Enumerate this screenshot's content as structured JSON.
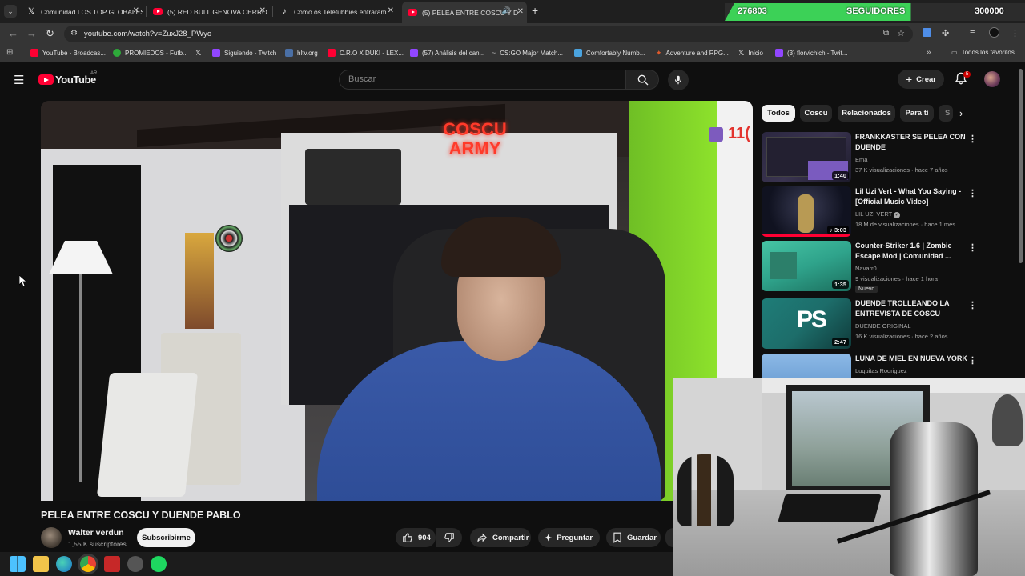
{
  "browser": {
    "tabs": [
      {
        "title": "Comunidad LOS TOP GLOBALES",
        "icon": "x-icon"
      },
      {
        "title": "(5) RED BULL GENOVA CERRO /",
        "icon": "youtube-icon"
      },
      {
        "title": "Como os Teletubbies entraram",
        "icon": "tiktok-icon"
      },
      {
        "title": "(5) PELEA ENTRE COSCU Y D",
        "icon": "youtube-icon",
        "active": true
      }
    ],
    "new_tab": "+",
    "url": "youtube.com/watch?v=ZuxJ28_PWyo",
    "bookmarks": [
      {
        "label": "YouTube - Broadcas...",
        "color": "#ff0033"
      },
      {
        "label": "PROMIEDOS - Futb...",
        "color": "#2eaa3a"
      },
      {
        "label": "",
        "color": "#ffffff"
      },
      {
        "label": "Siguiendo - Twitch",
        "color": "#9146ff"
      },
      {
        "label": "hltv.org",
        "color": "#4a6fa5"
      },
      {
        "label": "C.R.O X DUKI - LEX...",
        "color": "#ff0033"
      },
      {
        "label": "(57) Análisis del can...",
        "color": "#9146ff"
      },
      {
        "label": "CS:GO Major Match...",
        "color": "#bbbbbb"
      },
      {
        "label": "Comfortably Numb...",
        "color": "#4aa3df"
      },
      {
        "label": "Adventure and RPG...",
        "color": "#e05a2b"
      },
      {
        "label": "Inicio",
        "color": "#ffffff"
      },
      {
        "label": "(3) florvichich - Twit...",
        "color": "#9146ff"
      }
    ],
    "all_bookmarks": "Todos los favoritos"
  },
  "followers_overlay": {
    "current": "276803",
    "label": "SEGUIDORES",
    "goal": "300000",
    "progress": 0.62
  },
  "youtube": {
    "logo_text": "YouTube",
    "region": "AR",
    "search_placeholder": "Buscar",
    "create_label": "Crear",
    "notifications": "5",
    "video": {
      "title": "PELEA ENTRE COSCU Y DUENDE PABLO",
      "channel": "Walter verdun",
      "subscribers": "1,55 K suscriptores",
      "subscribe_label": "Subscribirme",
      "likes": "904",
      "share_label": "Compartir",
      "ask_label": "Preguntar",
      "save_label": "Guardar",
      "overlay_sign": "COSCU ARMY",
      "overlay_counter": "11("
    },
    "chips": [
      "Todos",
      "Coscu",
      "Relacionados",
      "Para ti",
      "S"
    ],
    "recommendations": [
      {
        "title": "FRANKKASTER SE PELEA CON DUENDE",
        "channel": "Ema",
        "stats": "37 K visualizaciones · hace 7 años",
        "duration": "1:40",
        "thumb": "#3a3450"
      },
      {
        "title": "Lil Uzi Vert - What You Saying - [Official Music Video]",
        "channel": "LIL UZI VERT",
        "verified": true,
        "stats": "18 M de visualizaciones · hace 1 mes",
        "duration": "3:03",
        "thumb": "#1a1c2c"
      },
      {
        "title": "Counter-Striker 1.6 | Zombie Escape Mod | Comunidad ...",
        "channel": "Navarr0",
        "stats": "9 visualizaciones · hace 1 hora",
        "duration": "1:35",
        "new_tag": "Nuevo",
        "thumb": "#2fa38b"
      },
      {
        "title": "DUENDE TROLLEANDO LA ENTREVISTA DE COSCU",
        "channel": "DUENDE ORIGINAL",
        "stats": "16 K visualizaciones · hace 2 años",
        "duration": "2:47",
        "thumb": "#1d6d6a"
      },
      {
        "title": "LUNA DE MIEL EN NUEVA YORK",
        "channel": "Luquitas Rodriguez",
        "stats": "",
        "duration": "",
        "thumb": "#5a8fc9"
      }
    ]
  }
}
